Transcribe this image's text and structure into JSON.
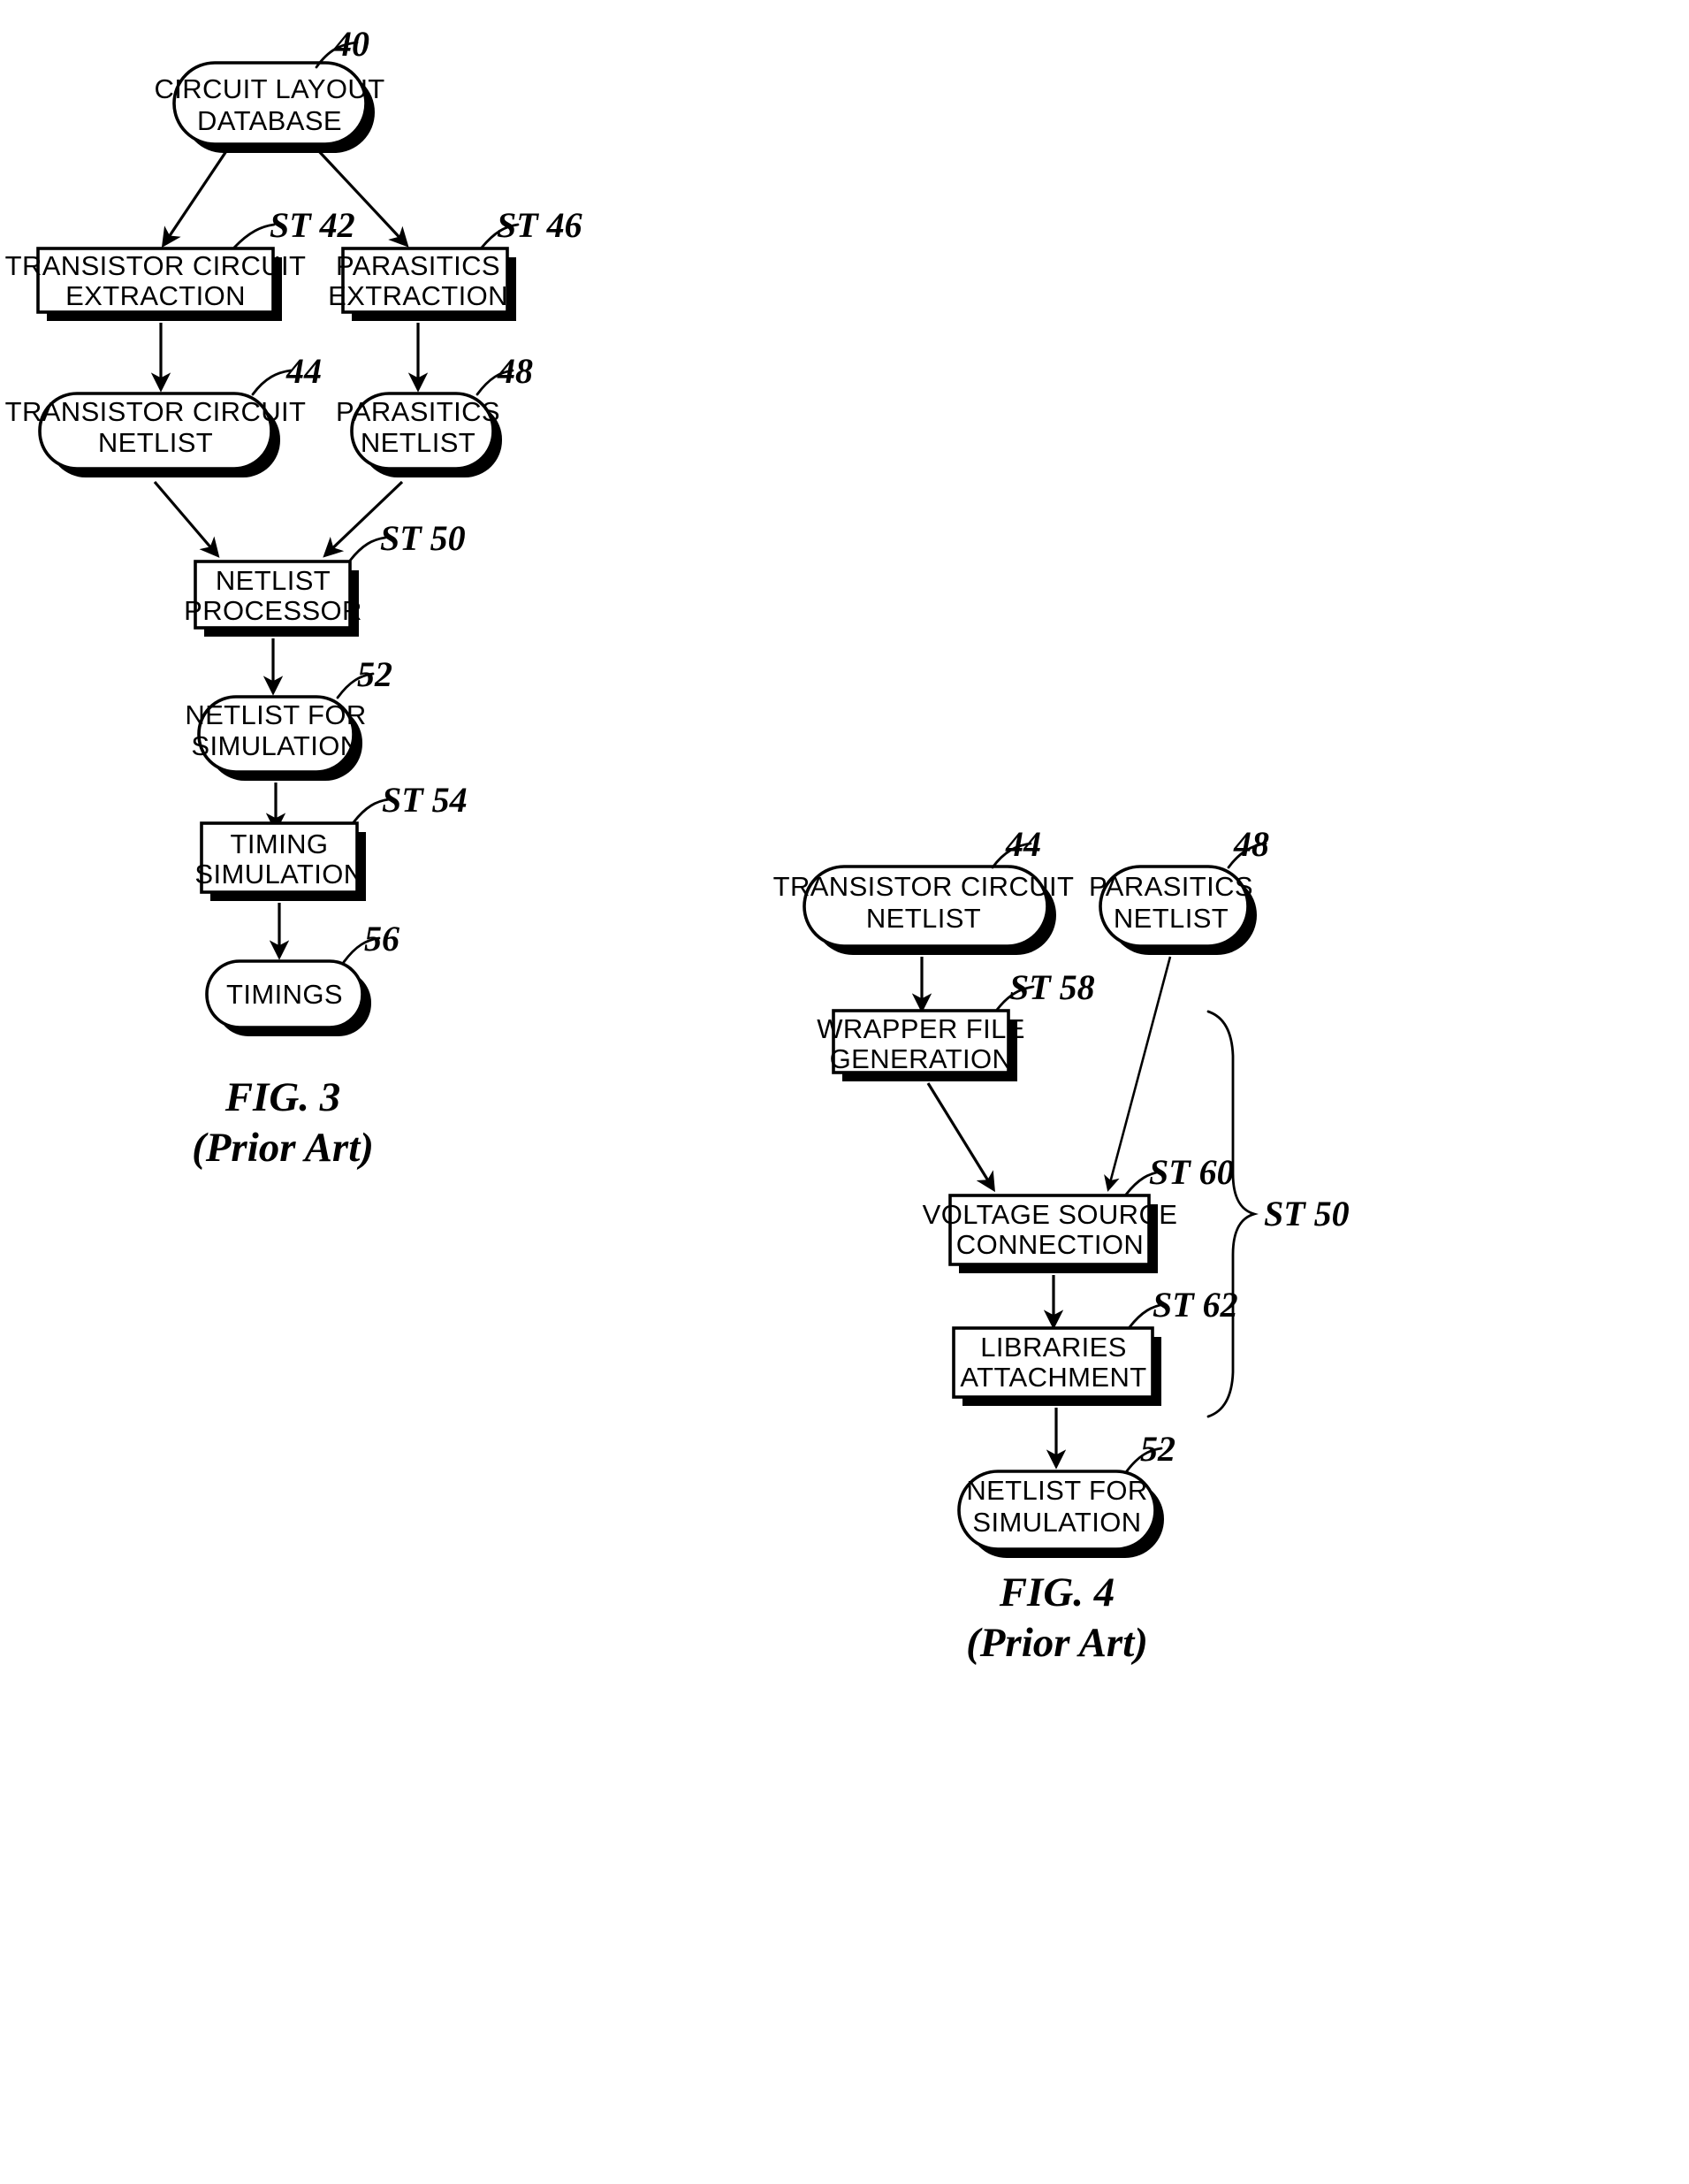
{
  "figures": [
    {
      "id": "fig3",
      "caption_line1": "FIG. 3",
      "caption_line2": "(Prior Art)",
      "nodes": [
        {
          "id": "n40",
          "shape": "rounded",
          "ref": "40",
          "line1": "CIRCUIT LAYOUT",
          "line2": "DATABASE"
        },
        {
          "id": "n42",
          "shape": "box",
          "ref": "ST 42",
          "line1": "TRANSISTOR CIRCUIT",
          "line2": "EXTRACTION"
        },
        {
          "id": "n46",
          "shape": "box",
          "ref": "ST 46",
          "line1": "PARASITICS",
          "line2": "EXTRACTION"
        },
        {
          "id": "n44",
          "shape": "rounded",
          "ref": "44",
          "line1": "TRANSISTOR CIRCUIT",
          "line2": "NETLIST"
        },
        {
          "id": "n48",
          "shape": "rounded",
          "ref": "48",
          "line1": "PARASITICS",
          "line2": "NETLIST"
        },
        {
          "id": "n50",
          "shape": "box",
          "ref": "ST 50",
          "line1": "NETLIST",
          "line2": "PROCESSOR"
        },
        {
          "id": "n52",
          "shape": "rounded",
          "ref": "52",
          "line1": "NETLIST FOR",
          "line2": "SIMULATION"
        },
        {
          "id": "n54",
          "shape": "box",
          "ref": "ST 54",
          "line1": "TIMING",
          "line2": "SIMULATION"
        },
        {
          "id": "n56",
          "shape": "rounded",
          "ref": "56",
          "line1": "TIMINGS",
          "line2": ""
        }
      ]
    },
    {
      "id": "fig4",
      "caption_line1": "FIG. 4",
      "caption_line2": "(Prior Art)",
      "group_bracket_label": "ST 50",
      "nodes": [
        {
          "id": "m44",
          "shape": "rounded",
          "ref": "44",
          "line1": "TRANSISTOR CIRCUIT",
          "line2": "NETLIST"
        },
        {
          "id": "m48",
          "shape": "rounded",
          "ref": "48",
          "line1": "PARASITICS",
          "line2": "NETLIST"
        },
        {
          "id": "m58",
          "shape": "box",
          "ref": "ST 58",
          "line1": "WRAPPER FILE",
          "line2": "GENERATION"
        },
        {
          "id": "m60",
          "shape": "box",
          "ref": "ST 60",
          "line1": "VOLTAGE SOURCE",
          "line2": "CONNECTION"
        },
        {
          "id": "m62",
          "shape": "box",
          "ref": "ST 62",
          "line1": "LIBRARIES",
          "line2": "ATTACHMENT"
        },
        {
          "id": "m52",
          "shape": "rounded",
          "ref": "52",
          "line1": "NETLIST FOR",
          "line2": "SIMULATION"
        }
      ]
    }
  ],
  "colors": {
    "ink": "#000000",
    "paper": "#ffffff"
  }
}
